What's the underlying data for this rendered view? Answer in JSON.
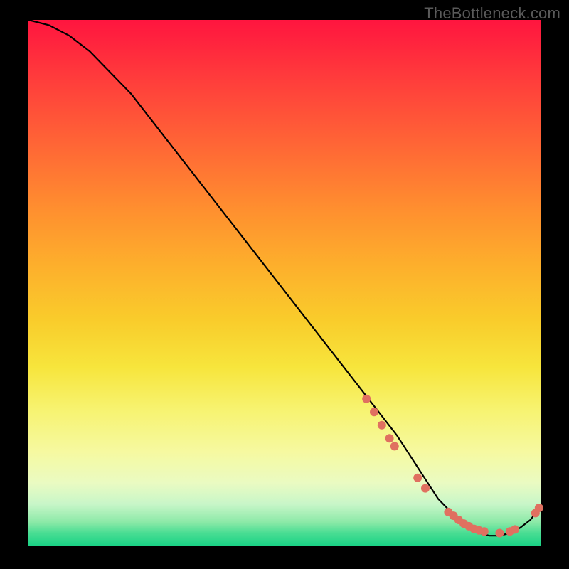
{
  "watermark": "TheBottleneck.com",
  "chart_data": {
    "type": "line",
    "title": "",
    "xlabel": "",
    "ylabel": "",
    "xlim": [
      0,
      100
    ],
    "ylim": [
      0,
      100
    ],
    "series": [
      {
        "name": "bottleneck-curve",
        "x": [
          0,
          4,
          8,
          12,
          16,
          20,
          24,
          28,
          32,
          36,
          40,
          44,
          48,
          52,
          56,
          60,
          64,
          68,
          72,
          74,
          76,
          78,
          80,
          82,
          84,
          86,
          88,
          90,
          92,
          94,
          96,
          98,
          100
        ],
        "y": [
          100,
          99,
          97,
          94,
          90,
          86,
          81,
          76,
          71,
          66,
          61,
          56,
          51,
          46,
          41,
          36,
          31,
          26,
          21,
          18,
          15,
          12,
          9,
          7,
          5,
          3.5,
          2.5,
          2,
          2,
          2.5,
          3.5,
          5,
          7.5
        ]
      }
    ],
    "markers": {
      "name": "highlight-dots",
      "color": "#e07060",
      "points": [
        {
          "x": 66,
          "y": 28
        },
        {
          "x": 67.5,
          "y": 25.5
        },
        {
          "x": 69,
          "y": 23
        },
        {
          "x": 70.5,
          "y": 20.5
        },
        {
          "x": 71.5,
          "y": 19
        },
        {
          "x": 76,
          "y": 13
        },
        {
          "x": 77.5,
          "y": 11
        },
        {
          "x": 82,
          "y": 6.5
        },
        {
          "x": 83,
          "y": 5.8
        },
        {
          "x": 84,
          "y": 5
        },
        {
          "x": 85,
          "y": 4.3
        },
        {
          "x": 86,
          "y": 3.8
        },
        {
          "x": 87,
          "y": 3.3
        },
        {
          "x": 88,
          "y": 3
        },
        {
          "x": 89,
          "y": 2.8
        },
        {
          "x": 92,
          "y": 2.5
        },
        {
          "x": 94,
          "y": 2.8
        },
        {
          "x": 95,
          "y": 3.2
        },
        {
          "x": 99,
          "y": 6.3
        },
        {
          "x": 99.7,
          "y": 7.3
        }
      ]
    }
  }
}
